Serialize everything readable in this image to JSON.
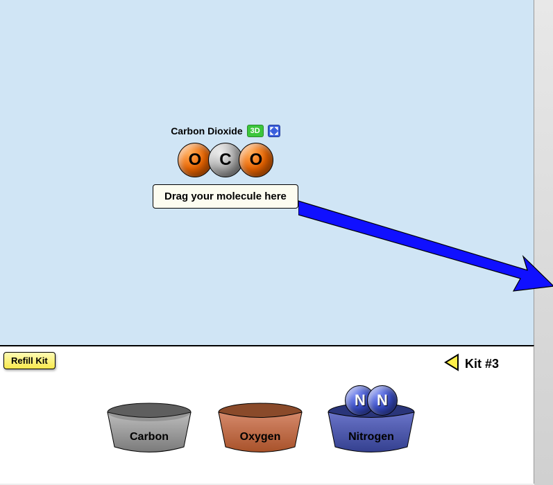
{
  "molecule": {
    "name": "Carbon Dioxide",
    "badge_3d": "3D",
    "atoms": [
      "O",
      "C",
      "O"
    ],
    "drop_text": "Drag your molecule here"
  },
  "toolbar": {
    "refill_label": "Refill Kit"
  },
  "kit": {
    "label": "Kit #3"
  },
  "buckets": [
    {
      "name": "Carbon",
      "color_top": "#bdbdbd",
      "color_body": "#8a8a8a",
      "atoms": []
    },
    {
      "name": "Oxygen",
      "color_top": "#d5896b",
      "color_body": "#b36236",
      "atoms": []
    },
    {
      "name": "Nitrogen",
      "color_top": "#6a74c9",
      "color_body": "#3e4a9f",
      "atoms": [
        "N",
        "N"
      ]
    }
  ],
  "colors": {
    "workspace_bg": "#d0e5f5",
    "arrow": "#1010ff"
  }
}
